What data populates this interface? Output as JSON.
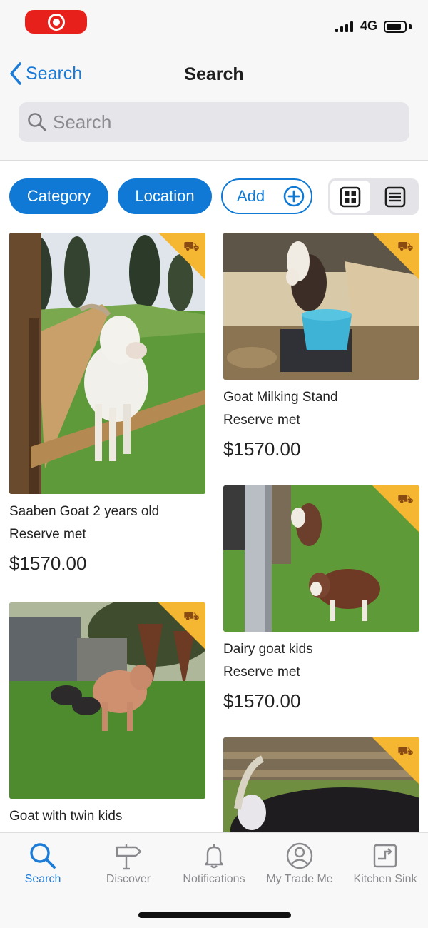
{
  "status_bar": {
    "network": "4G"
  },
  "nav": {
    "back_label": "Search",
    "title": "Search"
  },
  "search": {
    "placeholder": "Search"
  },
  "filters": {
    "category": "Category",
    "location": "Location",
    "add": "Add"
  },
  "listings": [
    {
      "title": "Saaben Goat 2 years old",
      "reserve": "Reserve met",
      "price": "$1570.00"
    },
    {
      "title": "Goat Milking Stand",
      "reserve": "Reserve met",
      "price": "$1570.00"
    },
    {
      "title": "Dairy goat kids",
      "reserve": "Reserve met",
      "price": "$1570.00"
    },
    {
      "title": "Goat with twin kids"
    },
    {}
  ],
  "tabs": [
    {
      "label": "Search",
      "icon": "search-icon"
    },
    {
      "label": "Discover",
      "icon": "signpost-icon"
    },
    {
      "label": "Notifications",
      "icon": "bell-icon"
    },
    {
      "label": "My Trade Me",
      "icon": "profile-icon"
    },
    {
      "label": "Kitchen Sink",
      "icon": "kitchen-sink-icon"
    }
  ],
  "colors": {
    "accent": "#0f79d5",
    "badge": "#f5b731",
    "active_tab": "#1c7bd6"
  }
}
